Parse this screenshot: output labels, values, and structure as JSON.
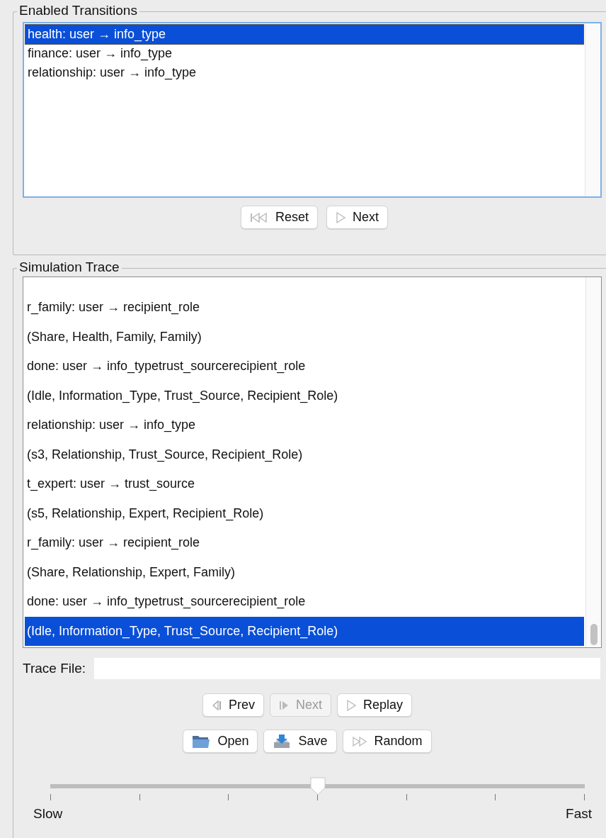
{
  "enabled_transitions": {
    "title": "Enabled Transitions",
    "items": [
      {
        "label": "health: user → info_type",
        "selected": true
      },
      {
        "label": "finance: user → info_type",
        "selected": false
      },
      {
        "label": "relationship: user → info_type",
        "selected": false
      }
    ],
    "buttons": [
      {
        "label": "Reset",
        "kind": "reset",
        "disabled": false
      },
      {
        "label": "Next",
        "kind": "play",
        "disabled": false
      }
    ]
  },
  "simulation_trace": {
    "title": "Simulation Trace",
    "items": [
      {
        "label": "r_family: user → recipient_role",
        "selected": false
      },
      {
        "label": "(Share, Health, Family, Family)",
        "selected": false
      },
      {
        "label": "done: user → info_typetrust_sourcerecipient_role",
        "selected": false
      },
      {
        "label": "(Idle, Information_Type, Trust_Source, Recipient_Role)",
        "selected": false
      },
      {
        "label": "relationship: user → info_type",
        "selected": false
      },
      {
        "label": "(s3, Relationship, Trust_Source, Recipient_Role)",
        "selected": false
      },
      {
        "label": "t_expert: user → trust_source",
        "selected": false
      },
      {
        "label": "(s5, Relationship, Expert, Recipient_Role)",
        "selected": false
      },
      {
        "label": "r_family: user → recipient_role",
        "selected": false
      },
      {
        "label": "(Share, Relationship, Expert, Family)",
        "selected": false
      },
      {
        "label": "done: user → info_typetrust_sourcerecipient_role",
        "selected": false
      },
      {
        "label": "(Idle, Information_Type, Trust_Source, Recipient_Role)",
        "selected": true
      }
    ],
    "trace_file": {
      "label": "Trace File:"
    },
    "button_rows": [
      [
        {
          "label": "Prev",
          "kind": "prev",
          "disabled": false
        },
        {
          "label": "Next",
          "kind": "next",
          "disabled": true
        },
        {
          "label": "Replay",
          "kind": "play",
          "disabled": false
        }
      ],
      [
        {
          "label": "Open",
          "kind": "folder",
          "disabled": false
        },
        {
          "label": "Save",
          "kind": "save",
          "disabled": false
        },
        {
          "label": "Random",
          "kind": "fast",
          "disabled": false
        }
      ]
    ],
    "speed_slider": {
      "level": 0.5,
      "min_label": "Slow",
      "max_label": "Fast"
    }
  }
}
